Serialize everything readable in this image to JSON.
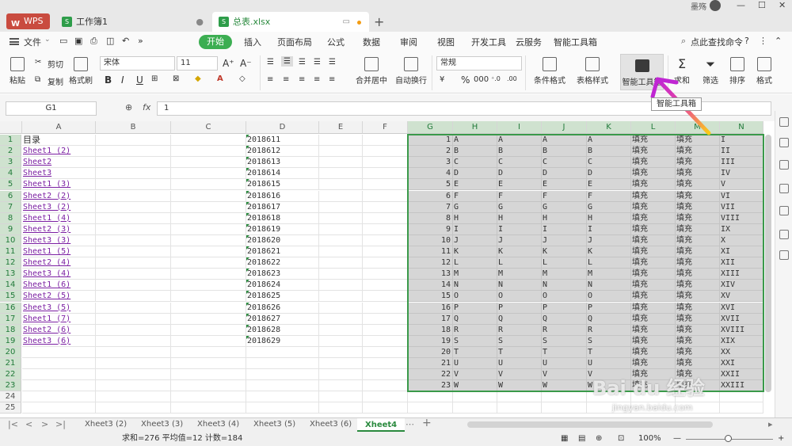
{
  "titlebar": {
    "wps_label": "WPS",
    "tab1": "工作簿1",
    "tab2": "总表.xlsx",
    "user": "墨殇",
    "win_min": "—",
    "win_max": "☐",
    "win_close": "✕"
  },
  "menu": {
    "file": "文件",
    "start": "开始",
    "items": [
      "插入",
      "页面布局",
      "公式",
      "数据",
      "审阅",
      "视图",
      "开发工具",
      "云服务",
      "智能工具箱"
    ],
    "search": "点此查找命令"
  },
  "ribbon": {
    "paste": "粘贴",
    "cut": "剪切",
    "copy": "复制",
    "format_painter": "格式刷",
    "font": "宋体",
    "size": "11",
    "bold": "B",
    "italic": "I",
    "underline": "U",
    "merge": "合并居中",
    "wrap": "自动换行",
    "number_format": "常规",
    "percent": "%",
    "cond_format": "条件格式",
    "table_style": "表格样式",
    "smart_toolbox": "智能工具箱",
    "sum": "求和",
    "filter": "筛选",
    "sort": "排序",
    "format": "格式"
  },
  "tooltip": "智能工具箱",
  "formula": {
    "cell_ref": "G1",
    "fx": "fx",
    "value": "1"
  },
  "columns": [
    "A",
    "B",
    "C",
    "D",
    "E",
    "F",
    "G",
    "H",
    "I",
    "J",
    "K",
    "L",
    "M",
    "N"
  ],
  "rows": [
    "1",
    "2",
    "3",
    "4",
    "5",
    "6",
    "7",
    "8",
    "9",
    "10",
    "11",
    "12",
    "13",
    "14",
    "15",
    "16",
    "17",
    "18",
    "19",
    "20",
    "21",
    "22",
    "23",
    "24",
    "25"
  ],
  "col_a": [
    "目录",
    "Sheet1 (2)",
    "Sheet2",
    "Sheet3",
    "Sheet1 (3)",
    "Sheet2 (2)",
    "Sheet3 (2)",
    "Sheet1 (4)",
    "Sheet2 (3)",
    "Sheet3 (3)",
    "Sheet1 (5)",
    "Sheet2 (4)",
    "Sheet3 (4)",
    "Sheet1 (6)",
    "Sheet2 (5)",
    "Sheet3 (5)",
    "Sheet1 (7)",
    "Sheet2 (6)",
    "Sheet3 (6)"
  ],
  "col_d": [
    "2018611",
    "2018612",
    "2018613",
    "2018614",
    "2018615",
    "2018616",
    "2018617",
    "2018618",
    "2018619",
    "2018620",
    "2018621",
    "2018622",
    "2018623",
    "2018624",
    "2018625",
    "2018626",
    "2018627",
    "2018628",
    "2018629"
  ],
  "col_g": [
    "1",
    "2",
    "3",
    "4",
    "5",
    "6",
    "7",
    "8",
    "9",
    "10",
    "11",
    "12",
    "13",
    "14",
    "15",
    "16",
    "17",
    "18",
    "19",
    "20",
    "21",
    "22",
    "23"
  ],
  "col_letters": [
    "A",
    "B",
    "C",
    "D",
    "E",
    "F",
    "G",
    "H",
    "I",
    "J",
    "K",
    "L",
    "M",
    "N",
    "O",
    "P",
    "Q",
    "R",
    "S",
    "T",
    "U",
    "V",
    "W"
  ],
  "fill_label": "填充",
  "col_n": [
    "I",
    "II",
    "III",
    "IV",
    "V",
    "VI",
    "VII",
    "VIII",
    "IX",
    "X",
    "XI",
    "XII",
    "XIII",
    "XIV",
    "XV",
    "XVI",
    "XVII",
    "XVIII",
    "XIX",
    "XX",
    "XXI",
    "XXII",
    "XXIII"
  ],
  "sheets": [
    "Xheet3 (2)",
    "Xheet3 (3)",
    "Xheet3 (4)",
    "Xheet3 (5)",
    "Xheet3 (6)",
    "Xheet4"
  ],
  "status": {
    "summary": "求和=276  平均值=12  计数=184",
    "zoom": "100%"
  },
  "watermark": {
    "main": "Bai du 经验",
    "sub": "jingyan.baidu.com"
  },
  "colors": {
    "accent": "#3cae52",
    "selection": "#3a9a4a",
    "link": "#7b1fa2"
  }
}
